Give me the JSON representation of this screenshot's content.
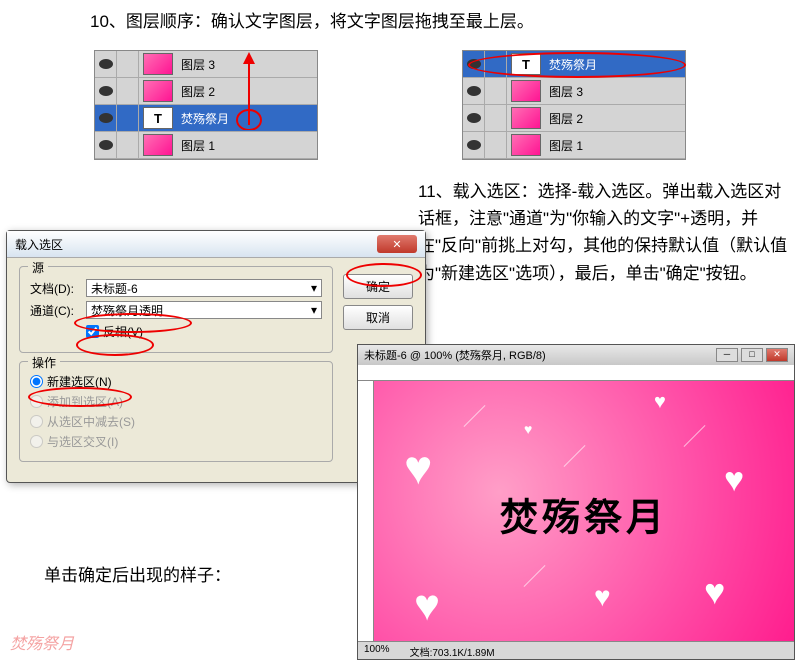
{
  "step10": "10、图层顺序：确认文字图层，将文字图层拖拽至最上层。",
  "step11": "11、载入选区：选择-载入选区。弹出载入选区对话框，注意\"通道\"为\"你输入的文字\"+透明，并在\"反向\"前挑上对勾，其他的保持默认值（默认值为\"新建选区\"选项），最后，单击\"确定\"按钮。",
  "afterConfirm": "单击确定后出现的样子：",
  "layersLeft": {
    "items": [
      {
        "name": "图层 3",
        "thumb": "pink",
        "eye": true
      },
      {
        "name": "图层 2",
        "thumb": "pink",
        "eye": true
      },
      {
        "name": "焚殇祭月",
        "thumb": "text",
        "eye": true,
        "selected": true
      },
      {
        "name": "图层 1",
        "thumb": "pink",
        "eye": true
      }
    ]
  },
  "layersRight": {
    "items": [
      {
        "name": "焚殇祭月",
        "thumb": "text",
        "eye": true,
        "selected": true
      },
      {
        "name": "图层 3",
        "thumb": "pink",
        "eye": true
      },
      {
        "name": "图层 2",
        "thumb": "pink",
        "eye": true
      },
      {
        "name": "图层 1",
        "thumb": "pink",
        "eye": true
      }
    ]
  },
  "dialog": {
    "title": "载入选区",
    "okBtn": "确定",
    "cancelBtn": "取消",
    "sourceLegend": "源",
    "docLabel": "文档(D):",
    "docValue": "未标题-6",
    "channelLabel": "通道(C):",
    "channelValue": "焚殇祭月透明",
    "invertLabel": "反相(V)",
    "opLegend": "操作",
    "opNew": "新建选区(N)",
    "opAdd": "添加到选区(A)",
    "opSub": "从选区中减去(S)",
    "opInt": "与选区交叉(I)"
  },
  "preview": {
    "title": "未标题-6 @ 100% (焚殇祭月, RGB/8)",
    "canvasText": "焚殇祭月",
    "zoom": "100%",
    "docInfo": "文档:703.1K/1.89M"
  },
  "textT": "T",
  "dropArrow": "▾"
}
